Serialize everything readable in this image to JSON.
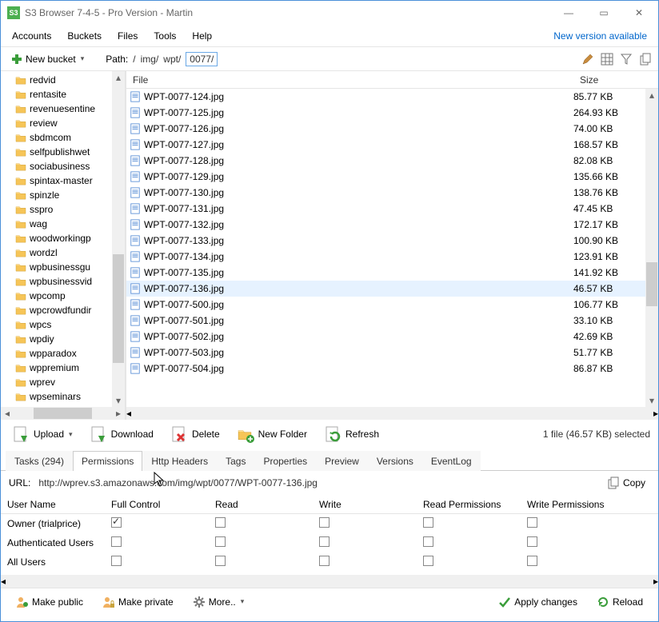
{
  "window": {
    "title": "S3 Browser 7-4-5 - Pro Version - Martin"
  },
  "menu": {
    "accounts": "Accounts",
    "buckets": "Buckets",
    "files": "Files",
    "tools": "Tools",
    "help": "Help",
    "new_version": "New version available"
  },
  "toolbar": {
    "new_bucket": "New bucket",
    "path_label": "Path:",
    "path": [
      "/",
      "img/",
      "wpt/",
      "0077/"
    ],
    "icons": {
      "edit": "edit-icon",
      "attrs": "attributes-icon",
      "filter": "filter-icon",
      "copy": "copy-icon"
    }
  },
  "sidebar": {
    "items": [
      "redvid",
      "rentasite",
      "revenuesentine",
      "review",
      "sbdmcom",
      "selfpublishwet",
      "sociabusiness",
      "spintax-master",
      "spinzle",
      "sspro",
      "wag",
      "woodworkingp",
      "wordzl",
      "wpbusinessgu",
      "wpbusinessvid",
      "wpcomp",
      "wpcrowdfundir",
      "wpcs",
      "wpdiy",
      "wpparadox",
      "wppremium",
      "wprev",
      "wpseminars"
    ]
  },
  "filelist": {
    "col_file": "File",
    "col_size": "Size",
    "rows": [
      {
        "name": "WPT-0077-124.jpg",
        "size": "85.77 KB"
      },
      {
        "name": "WPT-0077-125.jpg",
        "size": "264.93 KB"
      },
      {
        "name": "WPT-0077-126.jpg",
        "size": "74.00 KB"
      },
      {
        "name": "WPT-0077-127.jpg",
        "size": "168.57 KB"
      },
      {
        "name": "WPT-0077-128.jpg",
        "size": "82.08 KB"
      },
      {
        "name": "WPT-0077-129.jpg",
        "size": "135.66 KB"
      },
      {
        "name": "WPT-0077-130.jpg",
        "size": "138.76 KB"
      },
      {
        "name": "WPT-0077-131.jpg",
        "size": "47.45 KB"
      },
      {
        "name": "WPT-0077-132.jpg",
        "size": "172.17 KB"
      },
      {
        "name": "WPT-0077-133.jpg",
        "size": "100.90 KB"
      },
      {
        "name": "WPT-0077-134.jpg",
        "size": "123.91 KB"
      },
      {
        "name": "WPT-0077-135.jpg",
        "size": "141.92 KB"
      },
      {
        "name": "WPT-0077-136.jpg",
        "size": "46.57 KB",
        "selected": true
      },
      {
        "name": "WPT-0077-500.jpg",
        "size": "106.77 KB"
      },
      {
        "name": "WPT-0077-501.jpg",
        "size": "33.10 KB"
      },
      {
        "name": "WPT-0077-502.jpg",
        "size": "42.69 KB"
      },
      {
        "name": "WPT-0077-503.jpg",
        "size": "51.77 KB"
      },
      {
        "name": "WPT-0077-504.jpg",
        "size": "86.87 KB"
      }
    ]
  },
  "actions": {
    "upload": "Upload",
    "download": "Download",
    "delete": "Delete",
    "new_folder": "New Folder",
    "refresh": "Refresh",
    "status": "1 file (46.57 KB) selected"
  },
  "tabs": {
    "items": [
      {
        "label": "Tasks (294)"
      },
      {
        "label": "Permissions",
        "active": true
      },
      {
        "label": "Http Headers"
      },
      {
        "label": "Tags"
      },
      {
        "label": "Properties"
      },
      {
        "label": "Preview"
      },
      {
        "label": "Versions"
      },
      {
        "label": "EventLog"
      }
    ]
  },
  "url": {
    "label": "URL:",
    "value": "http://wprev.s3.amazonaws.com/img/wpt/0077/WPT-0077-136.jpg",
    "copy": "Copy"
  },
  "perms": {
    "cols": {
      "user": "User Name",
      "fc": "Full Control",
      "rd": "Read",
      "wr": "Write",
      "rp": "Read Permissions",
      "wp": "Write Permissions"
    },
    "rows": [
      {
        "user": "Owner (trialprice)",
        "fc": true,
        "rd": false,
        "wr": false,
        "rp": false,
        "wp": false
      },
      {
        "user": "Authenticated Users",
        "fc": false,
        "rd": false,
        "wr": false,
        "rp": false,
        "wp": false
      },
      {
        "user": "All Users",
        "fc": false,
        "rd": false,
        "wr": false,
        "rp": false,
        "wp": false
      }
    ]
  },
  "bottom": {
    "make_public": "Make public",
    "make_private": "Make private",
    "more": "More..",
    "apply": "Apply changes",
    "reload": "Reload"
  },
  "colors": {
    "accent": "#4a90d9",
    "selection": "#e6f2ff",
    "folder": "#f6c558"
  }
}
